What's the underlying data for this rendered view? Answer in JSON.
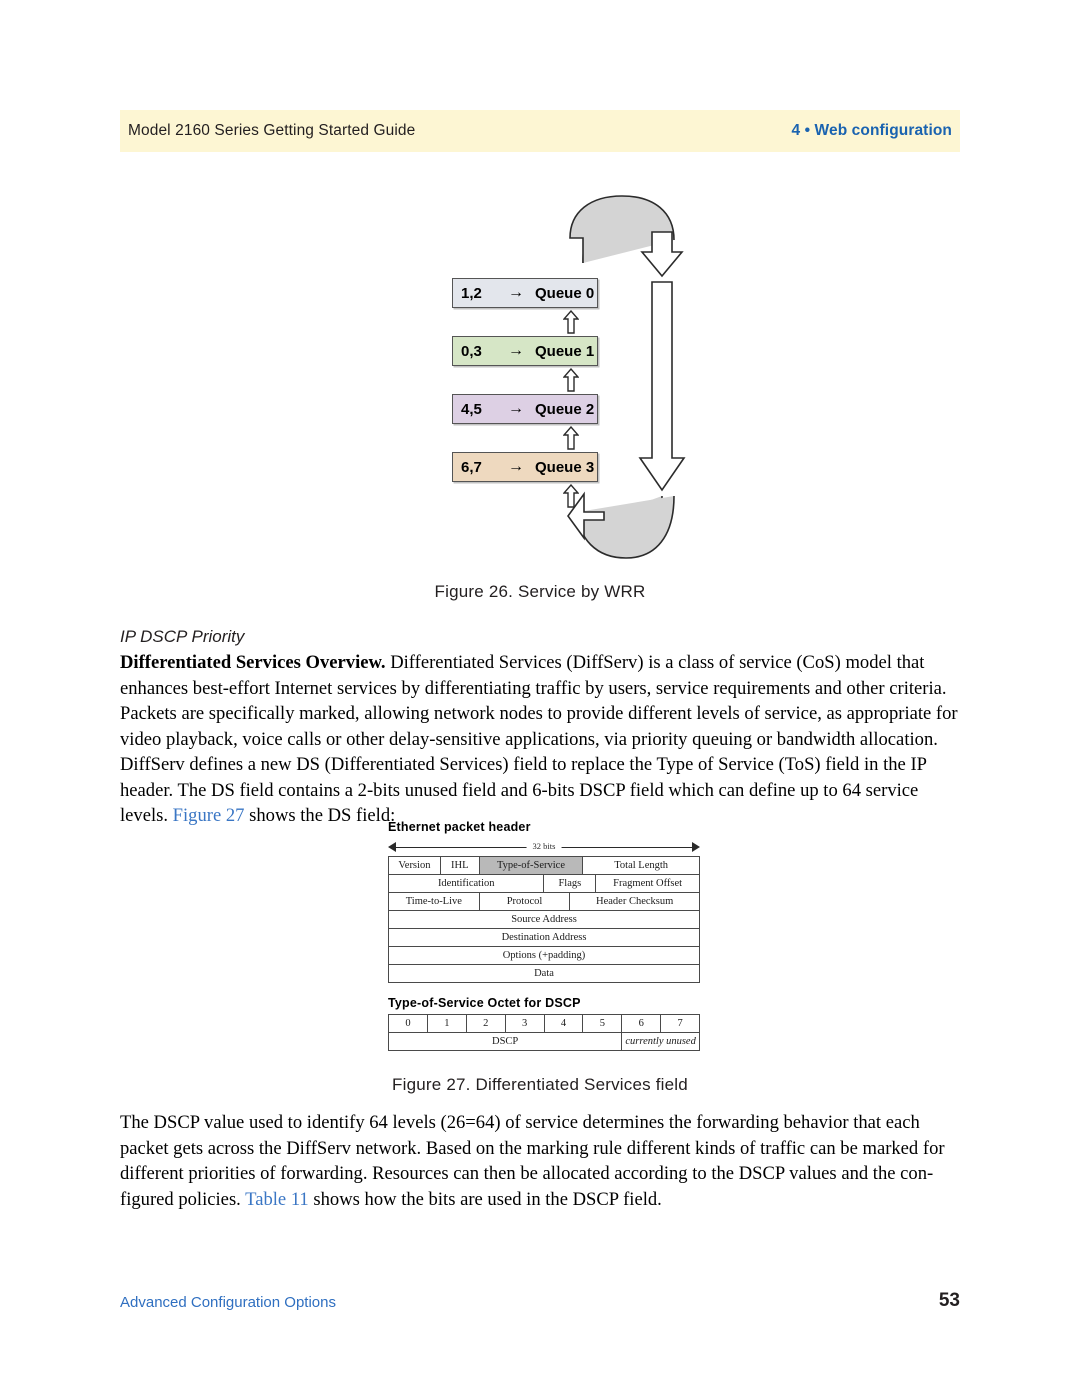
{
  "header": {
    "left_text": "Model 2160 Series Getting Started Guide",
    "right_text": "4 • Web configuration",
    "band_color": "#fdf6d3",
    "right_text_color": "#1a63b0"
  },
  "figure26": {
    "caption": "Figure 26. Service by WRR",
    "queues": [
      {
        "priorities": "1,2",
        "arrow": "→",
        "label": "Queue 0",
        "color": "#e3e6ec"
      },
      {
        "priorities": "0,3",
        "arrow": "→",
        "label": "Queue 1",
        "color": "#d6e6c6"
      },
      {
        "priorities": "4,5",
        "arrow": "→",
        "label": "Queue 2",
        "color": "#ddd0e4"
      },
      {
        "priorities": "6,7",
        "arrow": "→",
        "label": "Queue 3",
        "color": "#eed9bf"
      }
    ]
  },
  "section": {
    "title": "IP DSCP Priority",
    "overview_lead": "Differentiated Services Overview.",
    "overview_rest": " Differentiated Services (DiffServ) is a class of service (CoS) model that enhances best-effort Internet services by differentiating traffic by users, service requirements and other criteria. Packets are specifically marked, allowing network nodes to provide different levels of service, as appropriate for video playback, voice calls or other delay-sensitive applications, via priority queuing or bandwidth allocation.",
    "para2_a": "DiffServ defines a new DS (Differentiated Services) field to replace the Type of Service (ToS) field in the IP header. The DS field contains a 2-bits unused field and 6-bits DSCP field which can define up to 64 service levels. ",
    "para2_xref": "Figure 27",
    "para2_b": " shows the DS field:",
    "para3_a": "The DSCP value used to identify 64 levels (26=64) of service determines the forwarding behavior that each packet gets across the DiffServ network. Based on the marking rule different kinds of traffic can be marked for different priorities of forwarding. Resources can then be allocated according to the DSCP values and the con-figured policies. ",
    "para3_xref": "Table 11",
    "para3_b": " shows how the bits are used in the DSCP field."
  },
  "figure27": {
    "caption": "Figure 27. Differentiated Services field",
    "packet_heading": "Ethernet packet header",
    "bits_label": "32 bits",
    "ip_header_rows": [
      [
        "Version",
        "IHL",
        "Type-of-Service",
        "Total Length"
      ],
      [
        "Identification",
        "Flags",
        "Fragment Offset"
      ],
      [
        "Time-to-Live",
        "Protocol",
        "Header Checksum"
      ],
      [
        "Source Address"
      ],
      [
        "Destination Address"
      ],
      [
        "Options (+padding)"
      ],
      [
        "Data"
      ]
    ],
    "tos_heading": "Type-of-Service Octet for DSCP",
    "bit_numbers": [
      "0",
      "1",
      "2",
      "3",
      "4",
      "5",
      "6",
      "7"
    ],
    "dscp_label": "DSCP",
    "unused_label": "currently unused"
  },
  "footer": {
    "left_text": "Advanced Configuration Options",
    "page_number": "53"
  }
}
